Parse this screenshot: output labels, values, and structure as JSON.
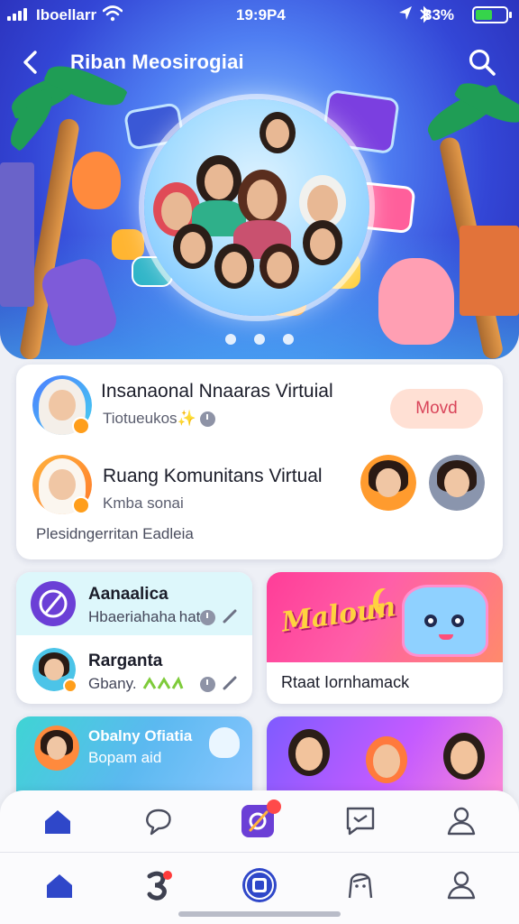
{
  "status_bar": {
    "carrier": "Iboellarr",
    "time": "19:9P4",
    "battery_pct": "33%",
    "battery_level": 0.55
  },
  "header": {
    "title": "Riban Meosirogiai",
    "back_icon": "chevron-left-icon",
    "search_icon": "search-icon"
  },
  "hero": {
    "carousel_pages": 3,
    "active_page": 0,
    "colors": {
      "sky": "#3346d6",
      "glow": "#69b9ff"
    }
  },
  "main_card": {
    "item1": {
      "title": "Insanaonal Nnaaras Virtuial",
      "subtitle": "Tiotueukos✨"
    },
    "move_button": "Movd",
    "item2": {
      "title": "Ruang Komunitans Virtual",
      "subtitle": "Kmba sonai"
    },
    "footer": "Plesidngerritan Eadleia"
  },
  "grid": {
    "card1": {
      "row1": {
        "title": "Aanaalica",
        "subtitle": "Hbaeriahaha hat"
      },
      "row2": {
        "title": "Rarganta",
        "subtitle": "Gbany."
      }
    },
    "card2": {
      "banner_text": "Maloun",
      "label": "Rtaat Iornhamack"
    },
    "card3": {
      "line1": "Obalny Ofiatia",
      "line2": "Bopam aid"
    }
  },
  "tabbar_top": [
    "home-icon",
    "chat-bubble-icon",
    "create-icon",
    "message-icon",
    "profile-icon"
  ],
  "tabbar_bottom": [
    "home-icon",
    "discover-icon",
    "app-icon",
    "avatar-icon",
    "profile-icon"
  ],
  "accent": "#3a4fd4"
}
